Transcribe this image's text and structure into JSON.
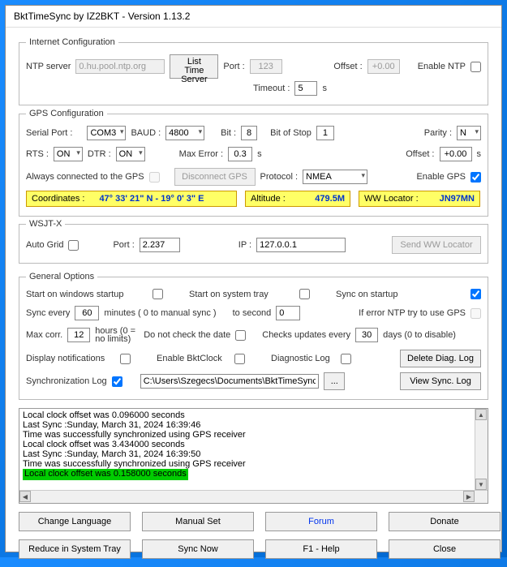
{
  "window": {
    "title": "BktTimeSync by IZ2BKT - Version 1.13.2"
  },
  "inet": {
    "legend": "Internet Configuration",
    "ntp_label": "NTP server",
    "ntp_value": "0.hu.pool.ntp.org",
    "list_btn": "List Time Server",
    "port_label": "Port :",
    "port_value": "123",
    "offset_label": "Offset :",
    "offset_value": "+0.00",
    "enable_label": "Enable NTP",
    "timeout_label": "Timeout :",
    "timeout_value": "5",
    "timeout_unit": "s"
  },
  "gps": {
    "legend": "GPS Configuration",
    "serial_label": "Serial Port :",
    "serial_value": "COM3",
    "baud_label": "BAUD :",
    "baud_value": "4800",
    "bit_label": "Bit :",
    "bit_value": "8",
    "stop_label": "Bit of Stop",
    "stop_value": "1",
    "parity_label": "Parity :",
    "parity_value": "N",
    "rts_label": "RTS :",
    "rts_value": "ON",
    "dtr_label": "DTR :",
    "dtr_value": "ON",
    "maxerr_label": "Max Error :",
    "maxerr_value": "0.3",
    "maxerr_unit": "s",
    "offset_label": "Offset :",
    "offset_value": "+0.00",
    "offset_unit": "s",
    "always_label": "Always connected to the GPS",
    "disconnect_btn": "Disconnect GPS",
    "protocol_label": "Protocol :",
    "protocol_value": "NMEA",
    "enable_label": "Enable GPS",
    "coord_label": "Coordinates :",
    "coord_value": "47° 33' 21\" N - 19° 0' 3\" E",
    "alt_label": "Altitude :",
    "alt_value": "479.5M",
    "loc_label": "WW Locator :",
    "loc_value": "JN97MN"
  },
  "wsjt": {
    "legend": "WSJT-X",
    "autogrid_label": "Auto Grid",
    "port_label": "Port :",
    "port_value": "2.237",
    "ip_label": "IP :",
    "ip_value": "127.0.0.1",
    "send_btn": "Send WW Locator"
  },
  "gen": {
    "legend": "General Options",
    "startwin_label": "Start on windows startup",
    "starttray_label": "Start on system tray",
    "syncstart_label": "Sync on startup",
    "syncevery_label": "Sync every",
    "syncevery_value": "60",
    "syncevery_unit": "minutes ( 0 to manual sync )",
    "tosecond_label": "to second",
    "tosecond_value": "0",
    "iferror_label": "If error NTP try to use GPS",
    "maxcorr_label": "Max corr.",
    "maxcorr_value": "12",
    "maxcorr_unit": "hours (0 = no limits)",
    "nocheck_label": "Do not check the date",
    "checkupd_label": "Checks updates every",
    "checkupd_value": "30",
    "checkupd_unit": "days (0 to disable)",
    "dispnotif_label": "Display notifications",
    "enclock_label": "Enable BktClock",
    "diaglog_label": "Diagnostic Log",
    "deldiag_btn": "Delete Diag. Log",
    "synclog_label": "Synchronization Log",
    "synclog_path": "C:\\Users\\Szegecs\\Documents\\BktTimeSyncLog.txt",
    "browse_btn": "...",
    "viewsync_btn": "View Sync. Log"
  },
  "log": {
    "l0": "Local clock offset was 0.096000 seconds",
    "l1": "Last Sync :Sunday, March 31, 2024 16:39:46",
    "l2": "Time was successfully synchronized using GPS receiver",
    "l3": "Local clock offset was 3.434000 seconds",
    "l4": "Last Sync :Sunday, March 31, 2024 16:39:50",
    "l5": "Time was successfully synchronized using GPS receiver",
    "l6": "Local clock offset was 0.158000 seconds"
  },
  "footer": {
    "lang": "Change Language",
    "manual": "Manual Set",
    "forum": "Forum",
    "donate": "Donate",
    "reduce": "Reduce in System Tray",
    "syncnow": "Sync Now",
    "help": "F1 - Help",
    "close": "Close"
  }
}
